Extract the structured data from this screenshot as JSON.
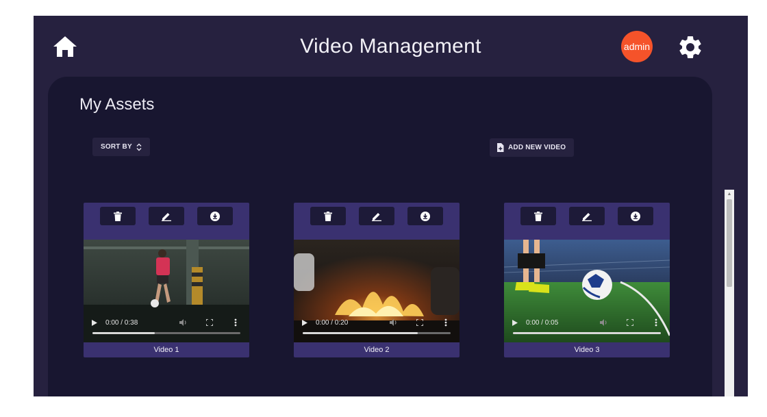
{
  "header": {
    "title": "Video Management",
    "home_icon": "home-icon",
    "avatar_text": "admin",
    "avatar_color": "#f5532a",
    "settings_icon": "gear-icon"
  },
  "panel": {
    "heading": "My Assets",
    "sort_label": "SORT BY",
    "sort_icon": "sort-arrows-icon",
    "add_label": "ADD NEW VIDEO",
    "add_icon": "file-add-icon"
  },
  "colors": {
    "app_bg": "#26213f",
    "panel_bg": "#181630",
    "card_accent": "#3a3170"
  },
  "videos": [
    {
      "label": "Video 1",
      "time": "0:00 / 0:38",
      "progress": 0.42
    },
    {
      "label": "Video 2",
      "time": "0:00 / 0:20",
      "progress": 0.78
    },
    {
      "label": "Video 3",
      "time": "0:00 / 0:05",
      "progress": 1.0
    }
  ],
  "card_actions": [
    "delete-icon",
    "edit-icon",
    "download-icon"
  ]
}
